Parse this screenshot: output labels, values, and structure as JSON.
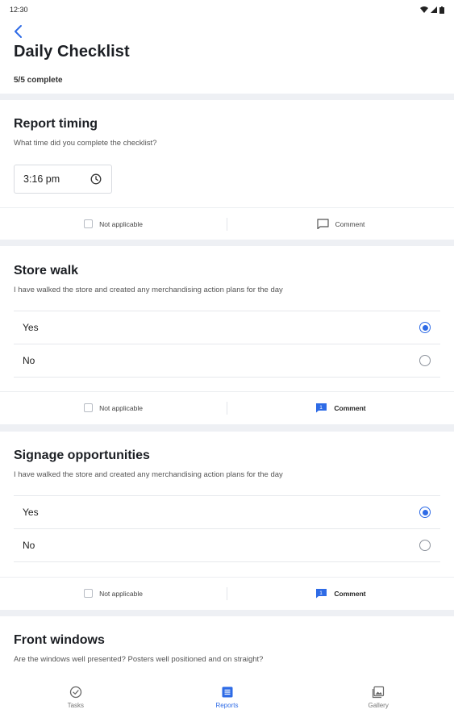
{
  "status_bar": {
    "time": "12:30"
  },
  "header": {
    "title": "Daily Checklist",
    "progress": "5/5 complete"
  },
  "sections": [
    {
      "title": "Report timing",
      "description": "What time did you complete the checklist?",
      "time_value": "3:16 pm",
      "footer": {
        "not_applicable": "Not applicable",
        "comment": "Comment"
      }
    },
    {
      "title": "Store walk",
      "description": "I have walked the store and created any merchandising action plans for the day",
      "options": [
        {
          "label": "Yes",
          "selected": true
        },
        {
          "label": "No",
          "selected": false
        }
      ],
      "footer": {
        "not_applicable": "Not applicable",
        "comment": "Comment",
        "comment_count": "1"
      }
    },
    {
      "title": "Signage opportunities",
      "description": "I have walked the store and created any merchandising action plans for the day",
      "options": [
        {
          "label": "Yes",
          "selected": true
        },
        {
          "label": "No",
          "selected": false
        }
      ],
      "footer": {
        "not_applicable": "Not applicable",
        "comment": "Comment",
        "comment_count": "1"
      }
    },
    {
      "title": "Front windows",
      "description": "Are the windows well presented? Posters well positioned and on straight?"
    }
  ],
  "bottom_nav": [
    {
      "label": "Tasks",
      "icon": "tasks-icon",
      "active": false
    },
    {
      "label": "Reports",
      "icon": "reports-icon",
      "active": true
    },
    {
      "label": "Gallery",
      "icon": "gallery-icon",
      "active": false
    }
  ],
  "colors": {
    "accent": "#2e6be6",
    "background": "#eef0f4",
    "card": "#ffffff"
  }
}
